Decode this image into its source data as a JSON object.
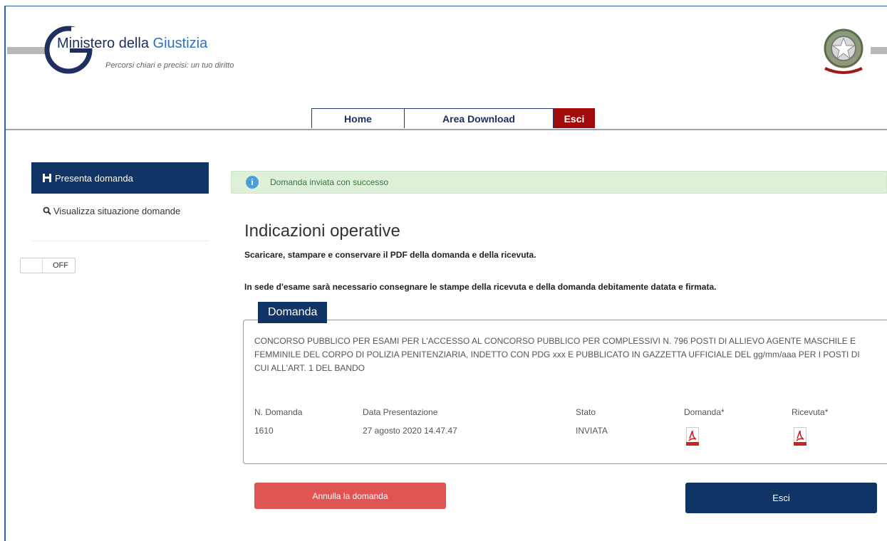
{
  "header": {
    "brand_prefix": "Ministero della ",
    "brand_highlight": "Giustizia",
    "tagline": "Percorsi chiari e precisi: un tuo diritto"
  },
  "nav": {
    "home": "Home",
    "download": "Area Download",
    "esci": "Esci"
  },
  "sidebar": {
    "items": [
      {
        "label": "Presenta domanda",
        "icon": "save-icon",
        "active": true
      },
      {
        "label": "Visualizza situazione domande",
        "icon": "search-icon",
        "active": false
      }
    ],
    "toggle_label": "OFF"
  },
  "alert": {
    "text": "Domanda inviata con successo",
    "color": "#dff0d8"
  },
  "main": {
    "title": "Indicazioni operative",
    "instruction_1": "Scaricare, stampare e conservare il PDF della domanda e della ricevuta.",
    "instruction_2": "In sede d'esame sarà necessario consegnare le stampe della ricevuta e della domanda debitamente datata e firmata.",
    "panel_title": "Domanda",
    "description": "CONCORSO PUBBLICO PER ESAMI PER L'ACCESSO AL CONCORSO PUBBLICO PER COMPLESSIVI N. 796 POSTI DI ALLIEVO AGENTE MASCHILE E FEMMINILE DEL CORPO DI POLIZIA PENITENZIARIA, INDETTO CON PDG xxx E PUBBLICATO IN GAZZETTA UFFICIALE DEL gg/mm/aaa PER I POSTI DI CUI ALL'ART. 1 DEL BANDO",
    "columns": {
      "n_domanda": "N. Domanda",
      "data": "Data Presentazione",
      "stato": "Stato",
      "domanda": "Domanda*",
      "ricevuta": "Ricevuta*"
    },
    "row": {
      "n_domanda": "1610",
      "data": "27 agosto 2020 14.47.47",
      "stato": "INVIATA"
    }
  },
  "buttons": {
    "annulla": "Annulla la domanda",
    "esci": "Esci"
  },
  "colors": {
    "navy": "#113466",
    "danger": "#e05454",
    "nav_esci": "#a00a0a"
  }
}
